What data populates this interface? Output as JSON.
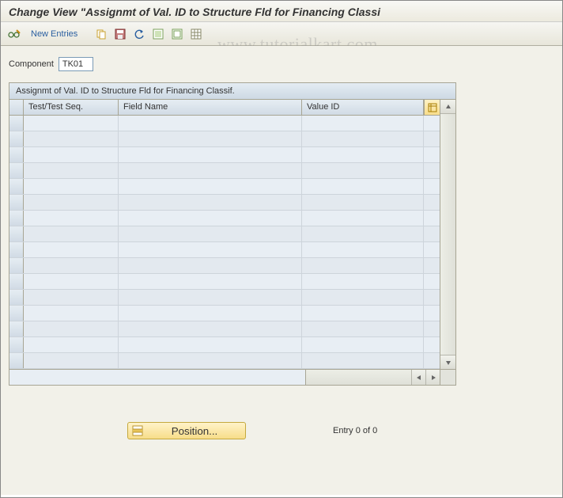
{
  "title": "Change View \"Assignmt of Val. ID to Structure Fld for Financing Classi",
  "toolbar": {
    "new_entries": "New Entries"
  },
  "component": {
    "label": "Component",
    "value": "TK01"
  },
  "table": {
    "title": "Assignmt of Val. ID to Structure Fld for Financing Classif.",
    "columns": {
      "c1": "Test/Test Seq.",
      "c2": "Field Name",
      "c3": "Value ID"
    },
    "row_count": 16
  },
  "footer": {
    "position_label": "Position...",
    "entry_text": "Entry 0 of 0"
  },
  "watermark": "www.tutorialkart.com"
}
